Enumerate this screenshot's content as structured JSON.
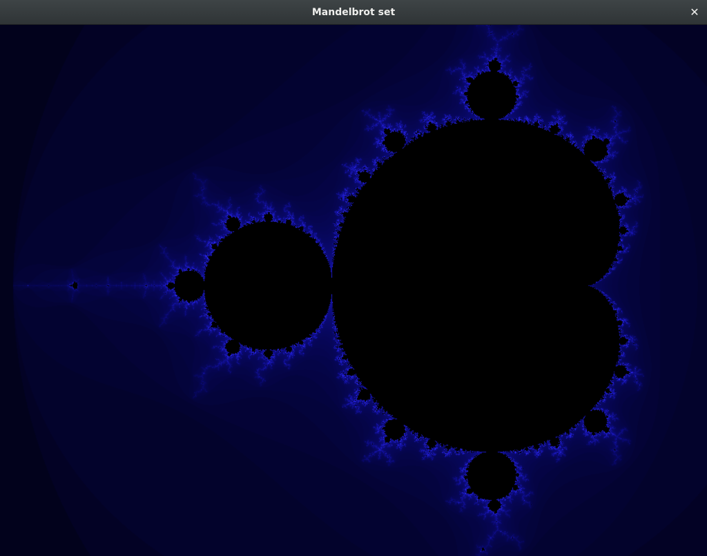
{
  "window": {
    "title": "Mandelbrot set",
    "close_glyph": "✕",
    "close_icon": "close-icon"
  },
  "fractal": {
    "name": "Mandelbrot set",
    "colors": {
      "inside": "#000000",
      "background": "#02020a",
      "edge": "#2b2bff"
    }
  }
}
